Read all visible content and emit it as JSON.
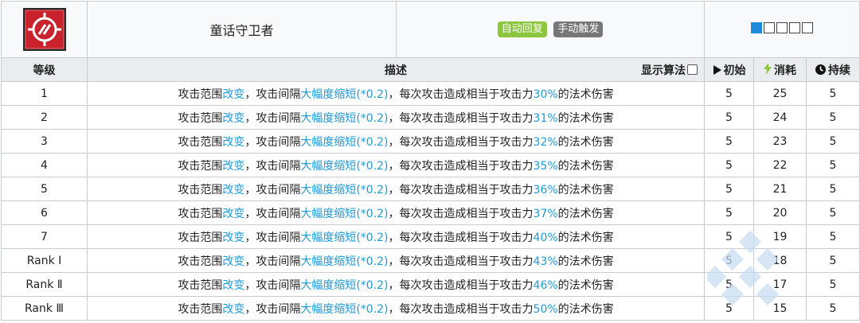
{
  "skill": {
    "name": "童话守卫者",
    "tags": [
      "自动回复",
      "手动触发"
    ],
    "sp_boxes": [
      true,
      false,
      false,
      false,
      false
    ]
  },
  "headers": {
    "level": "等级",
    "description": "描述",
    "show_formula": "显示算法",
    "initial": "初始",
    "cost": "消耗",
    "duration": "持续"
  },
  "rows": [
    {
      "level": "1",
      "d1": "攻击范围",
      "h1": "改变",
      "d2": "，攻击间隔",
      "h2": "大幅度缩短(*0.2)",
      "d3": "，每次攻击造成相当于攻击力",
      "h3": "30%",
      "d4": "的法术伤害",
      "initial": "5",
      "cost": "25",
      "duration": "5"
    },
    {
      "level": "2",
      "d1": "攻击范围",
      "h1": "改变",
      "d2": "，攻击间隔",
      "h2": "大幅度缩短(*0.2)",
      "d3": "，每次攻击造成相当于攻击力",
      "h3": "31%",
      "d4": "的法术伤害",
      "initial": "5",
      "cost": "24",
      "duration": "5"
    },
    {
      "level": "3",
      "d1": "攻击范围",
      "h1": "改变",
      "d2": "，攻击间隔",
      "h2": "大幅度缩短(*0.2)",
      "d3": "，每次攻击造成相当于攻击力",
      "h3": "32%",
      "d4": "的法术伤害",
      "initial": "5",
      "cost": "23",
      "duration": "5"
    },
    {
      "level": "4",
      "d1": "攻击范围",
      "h1": "改变",
      "d2": "，攻击间隔",
      "h2": "大幅度缩短(*0.2)",
      "d3": "，每次攻击造成相当于攻击力",
      "h3": "35%",
      "d4": "的法术伤害",
      "initial": "5",
      "cost": "22",
      "duration": "5"
    },
    {
      "level": "5",
      "d1": "攻击范围",
      "h1": "改变",
      "d2": "，攻击间隔",
      "h2": "大幅度缩短(*0.2)",
      "d3": "，每次攻击造成相当于攻击力",
      "h3": "36%",
      "d4": "的法术伤害",
      "initial": "5",
      "cost": "21",
      "duration": "5"
    },
    {
      "level": "6",
      "d1": "攻击范围",
      "h1": "改变",
      "d2": "，攻击间隔",
      "h2": "大幅度缩短(*0.2)",
      "d3": "，每次攻击造成相当于攻击力",
      "h3": "37%",
      "d4": "的法术伤害",
      "initial": "5",
      "cost": "20",
      "duration": "5"
    },
    {
      "level": "7",
      "d1": "攻击范围",
      "h1": "改变",
      "d2": "，攻击间隔",
      "h2": "大幅度缩短(*0.2)",
      "d3": "，每次攻击造成相当于攻击力",
      "h3": "40%",
      "d4": "的法术伤害",
      "initial": "5",
      "cost": "19",
      "duration": "5"
    },
    {
      "level": "Rank Ⅰ",
      "d1": "攻击范围",
      "h1": "改变",
      "d2": "，攻击间隔",
      "h2": "大幅度缩短(*0.2)",
      "d3": "，每次攻击造成相当于攻击力",
      "h3": "43%",
      "d4": "的法术伤害",
      "initial": "5",
      "cost": "18",
      "duration": "5"
    },
    {
      "level": "Rank Ⅱ",
      "d1": "攻击范围",
      "h1": "改变",
      "d2": "，攻击间隔",
      "h2": "大幅度缩短(*0.2)",
      "d3": "，每次攻击造成相当于攻击力",
      "h3": "46%",
      "d4": "的法术伤害",
      "initial": "5",
      "cost": "17",
      "duration": "5"
    },
    {
      "level": "Rank Ⅲ",
      "d1": "攻击范围",
      "h1": "改变",
      "d2": "，攻击间隔",
      "h2": "大幅度缩短(*0.2)",
      "d3": "，每次攻击造成相当于攻击力",
      "h3": "50%",
      "d4": "的法术伤害",
      "initial": "5",
      "cost": "15",
      "duration": "5"
    }
  ],
  "colors": {
    "highlight": "#1f9ad6",
    "tag_auto": "#8cc63f",
    "tag_manual": "#777777",
    "sp_filled": "#1f8ad8",
    "cost_icon": "#8cc63f",
    "skill_icon_bg": "#c8232c"
  },
  "icons": {
    "skill_icon": "skill-emblem-icon",
    "initial": "play-triangle-icon",
    "cost": "lightning-bolt-icon",
    "duration": "clock-icon",
    "watermark": "diamond-pattern-watermark"
  }
}
